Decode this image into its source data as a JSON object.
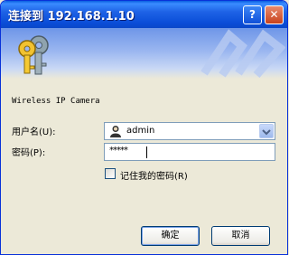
{
  "window": {
    "title": "连接到 192.168.1.10"
  },
  "titlebar": {
    "help_glyph": "?",
    "close_glyph": "✕"
  },
  "banner": {
    "icon": "keys-icon"
  },
  "dialog": {
    "realm": "Wireless IP Camera",
    "username_label": "用户名(U):",
    "username_value": "admin",
    "password_label": "密码(P):",
    "password_value": "*****",
    "remember_label": "记住我的密码(R)",
    "remember_checked": false
  },
  "buttons": {
    "ok": "确定",
    "cancel": "取消"
  },
  "colors": {
    "titlebar": "#0A5EE0",
    "face": "#ECE9D8",
    "input_border": "#7F9DB9",
    "close": "#C8421C"
  }
}
